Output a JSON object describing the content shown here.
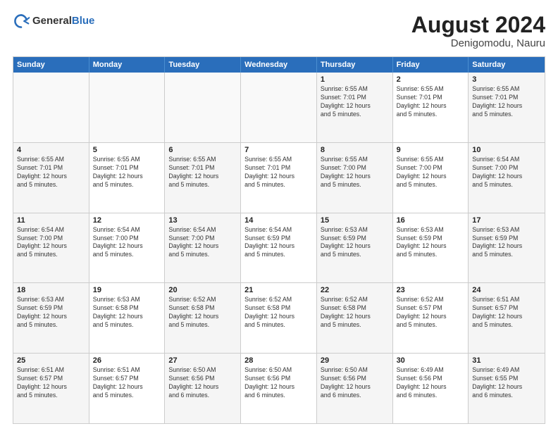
{
  "header": {
    "logo_general": "General",
    "logo_blue": "Blue",
    "title": "August 2024",
    "location": "Denigomodu, Nauru"
  },
  "days_of_week": [
    "Sunday",
    "Monday",
    "Tuesday",
    "Wednesday",
    "Thursday",
    "Friday",
    "Saturday"
  ],
  "weeks": [
    [
      {
        "day": "",
        "info": ""
      },
      {
        "day": "",
        "info": ""
      },
      {
        "day": "",
        "info": ""
      },
      {
        "day": "",
        "info": ""
      },
      {
        "day": "1",
        "info": "Sunrise: 6:55 AM\nSunset: 7:01 PM\nDaylight: 12 hours\nand 5 minutes."
      },
      {
        "day": "2",
        "info": "Sunrise: 6:55 AM\nSunset: 7:01 PM\nDaylight: 12 hours\nand 5 minutes."
      },
      {
        "day": "3",
        "info": "Sunrise: 6:55 AM\nSunset: 7:01 PM\nDaylight: 12 hours\nand 5 minutes."
      }
    ],
    [
      {
        "day": "4",
        "info": "Sunrise: 6:55 AM\nSunset: 7:01 PM\nDaylight: 12 hours\nand 5 minutes."
      },
      {
        "day": "5",
        "info": "Sunrise: 6:55 AM\nSunset: 7:01 PM\nDaylight: 12 hours\nand 5 minutes."
      },
      {
        "day": "6",
        "info": "Sunrise: 6:55 AM\nSunset: 7:01 PM\nDaylight: 12 hours\nand 5 minutes."
      },
      {
        "day": "7",
        "info": "Sunrise: 6:55 AM\nSunset: 7:01 PM\nDaylight: 12 hours\nand 5 minutes."
      },
      {
        "day": "8",
        "info": "Sunrise: 6:55 AM\nSunset: 7:00 PM\nDaylight: 12 hours\nand 5 minutes."
      },
      {
        "day": "9",
        "info": "Sunrise: 6:55 AM\nSunset: 7:00 PM\nDaylight: 12 hours\nand 5 minutes."
      },
      {
        "day": "10",
        "info": "Sunrise: 6:54 AM\nSunset: 7:00 PM\nDaylight: 12 hours\nand 5 minutes."
      }
    ],
    [
      {
        "day": "11",
        "info": "Sunrise: 6:54 AM\nSunset: 7:00 PM\nDaylight: 12 hours\nand 5 minutes."
      },
      {
        "day": "12",
        "info": "Sunrise: 6:54 AM\nSunset: 7:00 PM\nDaylight: 12 hours\nand 5 minutes."
      },
      {
        "day": "13",
        "info": "Sunrise: 6:54 AM\nSunset: 7:00 PM\nDaylight: 12 hours\nand 5 minutes."
      },
      {
        "day": "14",
        "info": "Sunrise: 6:54 AM\nSunset: 6:59 PM\nDaylight: 12 hours\nand 5 minutes."
      },
      {
        "day": "15",
        "info": "Sunrise: 6:53 AM\nSunset: 6:59 PM\nDaylight: 12 hours\nand 5 minutes."
      },
      {
        "day": "16",
        "info": "Sunrise: 6:53 AM\nSunset: 6:59 PM\nDaylight: 12 hours\nand 5 minutes."
      },
      {
        "day": "17",
        "info": "Sunrise: 6:53 AM\nSunset: 6:59 PM\nDaylight: 12 hours\nand 5 minutes."
      }
    ],
    [
      {
        "day": "18",
        "info": "Sunrise: 6:53 AM\nSunset: 6:59 PM\nDaylight: 12 hours\nand 5 minutes."
      },
      {
        "day": "19",
        "info": "Sunrise: 6:53 AM\nSunset: 6:58 PM\nDaylight: 12 hours\nand 5 minutes."
      },
      {
        "day": "20",
        "info": "Sunrise: 6:52 AM\nSunset: 6:58 PM\nDaylight: 12 hours\nand 5 minutes."
      },
      {
        "day": "21",
        "info": "Sunrise: 6:52 AM\nSunset: 6:58 PM\nDaylight: 12 hours\nand 5 minutes."
      },
      {
        "day": "22",
        "info": "Sunrise: 6:52 AM\nSunset: 6:58 PM\nDaylight: 12 hours\nand 5 minutes."
      },
      {
        "day": "23",
        "info": "Sunrise: 6:52 AM\nSunset: 6:57 PM\nDaylight: 12 hours\nand 5 minutes."
      },
      {
        "day": "24",
        "info": "Sunrise: 6:51 AM\nSunset: 6:57 PM\nDaylight: 12 hours\nand 5 minutes."
      }
    ],
    [
      {
        "day": "25",
        "info": "Sunrise: 6:51 AM\nSunset: 6:57 PM\nDaylight: 12 hours\nand 5 minutes."
      },
      {
        "day": "26",
        "info": "Sunrise: 6:51 AM\nSunset: 6:57 PM\nDaylight: 12 hours\nand 5 minutes."
      },
      {
        "day": "27",
        "info": "Sunrise: 6:50 AM\nSunset: 6:56 PM\nDaylight: 12 hours\nand 6 minutes."
      },
      {
        "day": "28",
        "info": "Sunrise: 6:50 AM\nSunset: 6:56 PM\nDaylight: 12 hours\nand 6 minutes."
      },
      {
        "day": "29",
        "info": "Sunrise: 6:50 AM\nSunset: 6:56 PM\nDaylight: 12 hours\nand 6 minutes."
      },
      {
        "day": "30",
        "info": "Sunrise: 6:49 AM\nSunset: 6:56 PM\nDaylight: 12 hours\nand 6 minutes."
      },
      {
        "day": "31",
        "info": "Sunrise: 6:49 AM\nSunset: 6:55 PM\nDaylight: 12 hours\nand 6 minutes."
      }
    ]
  ]
}
